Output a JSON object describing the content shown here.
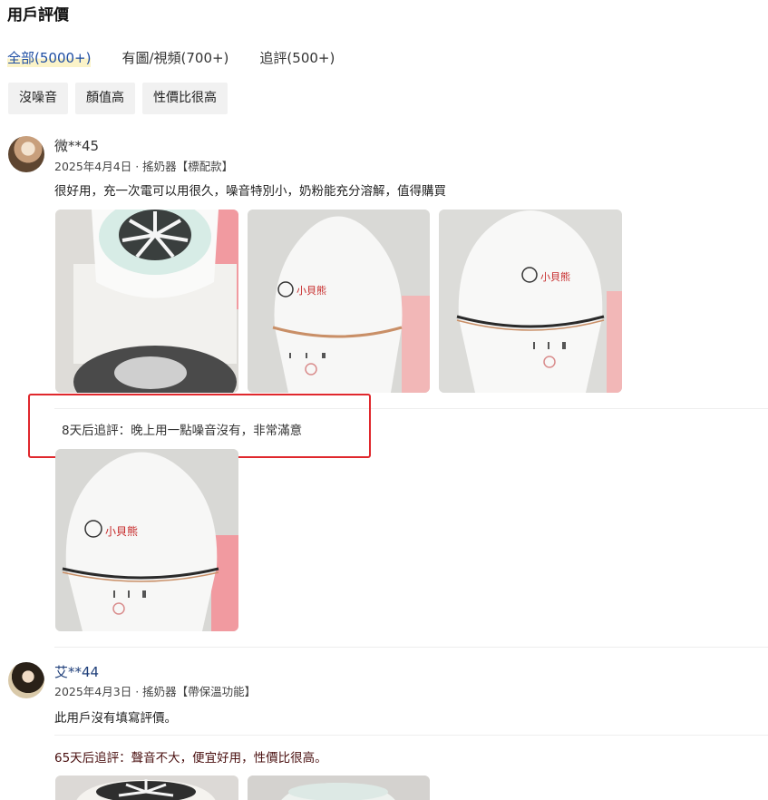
{
  "section": {
    "title": "用戶評價"
  },
  "filters": [
    {
      "label": "全部(5000+)",
      "active": true
    },
    {
      "label": "有圖/視頻(700+)",
      "active": false
    },
    {
      "label": "追評(500+)",
      "active": false
    }
  ],
  "tags": [
    "沒噪音",
    "顏值高",
    "性價比很高"
  ],
  "reviews": [
    {
      "user": "微**45",
      "meta": "2025年4月4日 · 搖奶器【標配款】",
      "text": "很好用，充一次電可以用很久，噪音特別小，奶粉能充分溶解，值得購買",
      "photo_brand": "小貝熊",
      "followup": {
        "text": "8天后追評：晚上用一點噪音沒有，非常滿意"
      }
    },
    {
      "user": "艾**44",
      "meta": "2025年4月3日 · 搖奶器【帶保溫功能】",
      "text": "此用戶沒有填寫評價。",
      "followup": {
        "text": "65天后追評：聲音不大，便宜好用，性價比很高。"
      }
    }
  ],
  "colors": {
    "accent": "#1f4ea3",
    "highlight_border": "#e0282d",
    "tag_bg": "#f1f1f1"
  }
}
